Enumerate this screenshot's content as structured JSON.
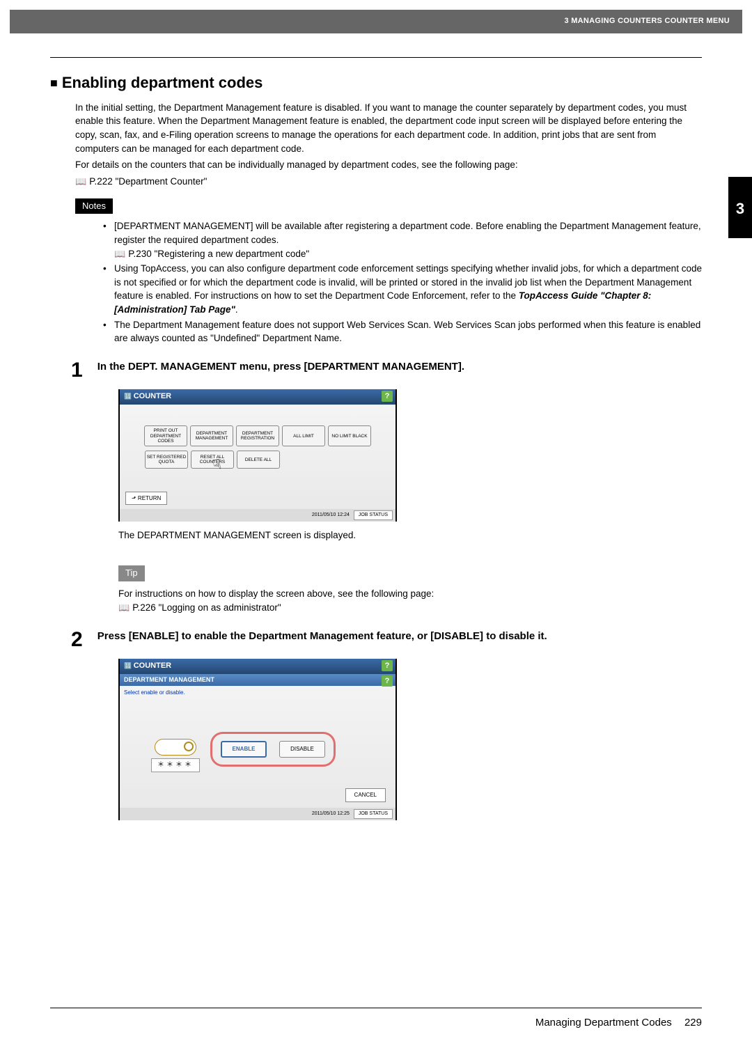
{
  "header": {
    "breadcrumb": "3 MANAGING COUNTERS COUNTER MENU"
  },
  "sideTab": {
    "chapter": "3"
  },
  "section": {
    "title": "Enabling department codes",
    "intro": "In the initial setting, the Department Management feature is disabled. If you want to manage the counter separately by department codes, you must enable this feature. When the Department Management feature is enabled, the department code input screen will be displayed before entering the copy, scan, fax, and e-Filing operation screens to manage the operations for each department code. In addition, print jobs that are sent from computers can be managed for each department code.",
    "detailsLead": "For details on the counters that can be individually managed by department codes, see the following page:",
    "ref1": "P.222 \"Department Counter\""
  },
  "notes": {
    "label": "Notes",
    "items": [
      {
        "text": "[DEPARTMENT MANAGEMENT] will be available after registering a department code. Before enabling the Department Management feature, register the required department codes.",
        "ref": "P.230 \"Registering a new department code\""
      },
      {
        "text_a": "Using TopAccess, you can also configure department code enforcement settings specifying whether invalid jobs, for which a department code is not specified or for which the department code is invalid, will be printed or stored in the invalid job list when the Department Management feature is enabled. For instructions on how to set the Department Code Enforcement, refer to the ",
        "text_b": "TopAccess Guide \"Chapter 8: [Administration] Tab Page\"",
        "text_c": "."
      },
      {
        "text": "The Department Management feature does not support Web Services Scan. Web Services Scan jobs performed when this feature is enabled are always counted as \"Undefined\" Department Name."
      }
    ]
  },
  "step1": {
    "num": "1",
    "heading": "In the DEPT. MANAGEMENT menu, press [DEPARTMENT MANAGEMENT].",
    "screen": {
      "title": "COUNTER",
      "buttons_row1": [
        "PRINT OUT DEPARTMENT CODES",
        "DEPARTMENT MANAGEMENT",
        "DEPARTMENT REGISTRATION",
        "ALL LIMIT",
        "NO LIMIT BLACK"
      ],
      "buttons_row2": [
        "SET REGISTERED QUOTA",
        "RESET ALL COUNTERS",
        "DELETE ALL"
      ],
      "return": "⬏  RETURN",
      "timestamp": "2011/05/10 12:24",
      "jobstatus": "JOB STATUS"
    },
    "afterText": "The DEPARTMENT MANAGEMENT screen is displayed.",
    "tip": {
      "label": "Tip",
      "text": "For instructions on how to display the screen above, see the following page:",
      "ref": "P.226 \"Logging on as administrator\""
    }
  },
  "step2": {
    "num": "2",
    "heading": "Press [ENABLE] to enable the Department Management feature, or [DISABLE] to disable it.",
    "screen": {
      "title": "COUNTER",
      "subtitle": "DEPARTMENT MANAGEMENT",
      "instruction": "Select enable or disable.",
      "stars": "＊＊＊＊",
      "enable": "ENABLE",
      "disable": "DISABLE",
      "cancel": "CANCEL",
      "timestamp": "2011/05/10 12:25",
      "jobstatus": "JOB STATUS"
    }
  },
  "footer": {
    "text": "Managing Department Codes",
    "page": "229"
  }
}
